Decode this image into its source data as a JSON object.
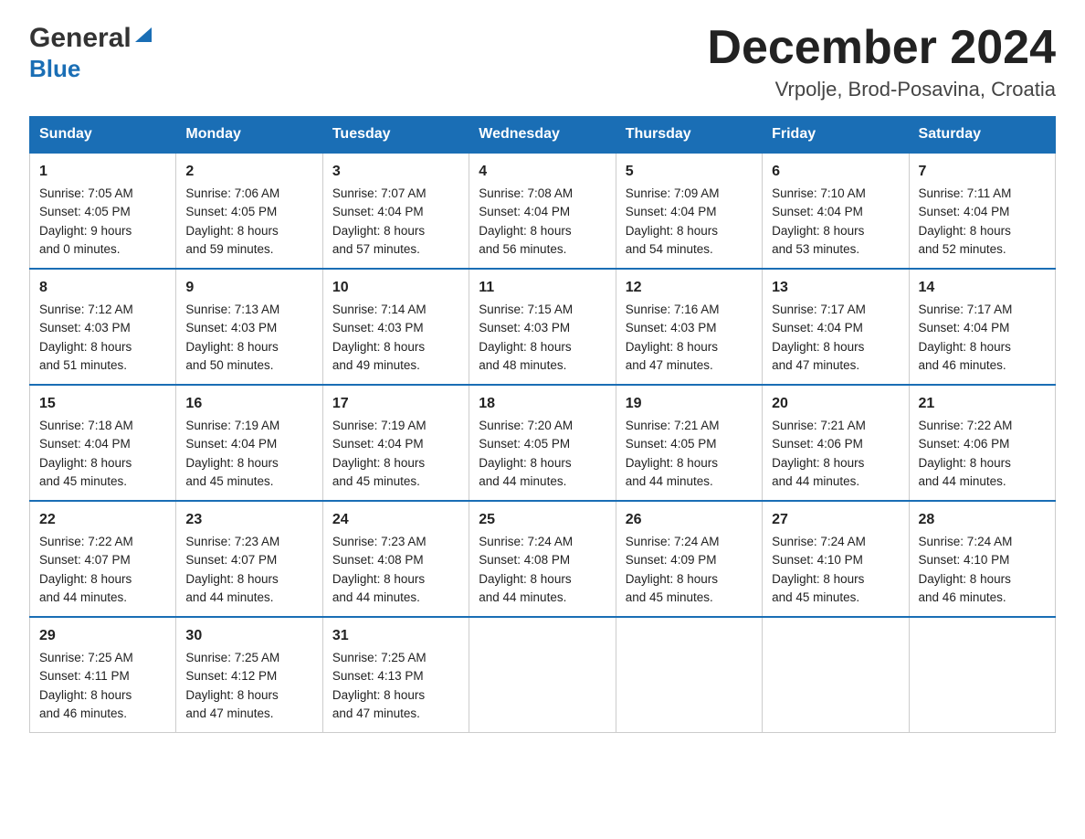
{
  "header": {
    "logo_general": "General",
    "logo_blue": "Blue",
    "month_title": "December 2024",
    "location": "Vrpolje, Brod-Posavina, Croatia"
  },
  "days_of_week": [
    "Sunday",
    "Monday",
    "Tuesday",
    "Wednesday",
    "Thursday",
    "Friday",
    "Saturday"
  ],
  "weeks": [
    [
      {
        "day": "1",
        "sunrise": "7:05 AM",
        "sunset": "4:05 PM",
        "daylight_hours": "9",
        "daylight_minutes": "0"
      },
      {
        "day": "2",
        "sunrise": "7:06 AM",
        "sunset": "4:05 PM",
        "daylight_hours": "8",
        "daylight_minutes": "59"
      },
      {
        "day": "3",
        "sunrise": "7:07 AM",
        "sunset": "4:04 PM",
        "daylight_hours": "8",
        "daylight_minutes": "57"
      },
      {
        "day": "4",
        "sunrise": "7:08 AM",
        "sunset": "4:04 PM",
        "daylight_hours": "8",
        "daylight_minutes": "56"
      },
      {
        "day": "5",
        "sunrise": "7:09 AM",
        "sunset": "4:04 PM",
        "daylight_hours": "8",
        "daylight_minutes": "54"
      },
      {
        "day": "6",
        "sunrise": "7:10 AM",
        "sunset": "4:04 PM",
        "daylight_hours": "8",
        "daylight_minutes": "53"
      },
      {
        "day": "7",
        "sunrise": "7:11 AM",
        "sunset": "4:04 PM",
        "daylight_hours": "8",
        "daylight_minutes": "52"
      }
    ],
    [
      {
        "day": "8",
        "sunrise": "7:12 AM",
        "sunset": "4:03 PM",
        "daylight_hours": "8",
        "daylight_minutes": "51"
      },
      {
        "day": "9",
        "sunrise": "7:13 AM",
        "sunset": "4:03 PM",
        "daylight_hours": "8",
        "daylight_minutes": "50"
      },
      {
        "day": "10",
        "sunrise": "7:14 AM",
        "sunset": "4:03 PM",
        "daylight_hours": "8",
        "daylight_minutes": "49"
      },
      {
        "day": "11",
        "sunrise": "7:15 AM",
        "sunset": "4:03 PM",
        "daylight_hours": "8",
        "daylight_minutes": "48"
      },
      {
        "day": "12",
        "sunrise": "7:16 AM",
        "sunset": "4:03 PM",
        "daylight_hours": "8",
        "daylight_minutes": "47"
      },
      {
        "day": "13",
        "sunrise": "7:17 AM",
        "sunset": "4:04 PM",
        "daylight_hours": "8",
        "daylight_minutes": "47"
      },
      {
        "day": "14",
        "sunrise": "7:17 AM",
        "sunset": "4:04 PM",
        "daylight_hours": "8",
        "daylight_minutes": "46"
      }
    ],
    [
      {
        "day": "15",
        "sunrise": "7:18 AM",
        "sunset": "4:04 PM",
        "daylight_hours": "8",
        "daylight_minutes": "45"
      },
      {
        "day": "16",
        "sunrise": "7:19 AM",
        "sunset": "4:04 PM",
        "daylight_hours": "8",
        "daylight_minutes": "45"
      },
      {
        "day": "17",
        "sunrise": "7:19 AM",
        "sunset": "4:04 PM",
        "daylight_hours": "8",
        "daylight_minutes": "45"
      },
      {
        "day": "18",
        "sunrise": "7:20 AM",
        "sunset": "4:05 PM",
        "daylight_hours": "8",
        "daylight_minutes": "44"
      },
      {
        "day": "19",
        "sunrise": "7:21 AM",
        "sunset": "4:05 PM",
        "daylight_hours": "8",
        "daylight_minutes": "44"
      },
      {
        "day": "20",
        "sunrise": "7:21 AM",
        "sunset": "4:06 PM",
        "daylight_hours": "8",
        "daylight_minutes": "44"
      },
      {
        "day": "21",
        "sunrise": "7:22 AM",
        "sunset": "4:06 PM",
        "daylight_hours": "8",
        "daylight_minutes": "44"
      }
    ],
    [
      {
        "day": "22",
        "sunrise": "7:22 AM",
        "sunset": "4:07 PM",
        "daylight_hours": "8",
        "daylight_minutes": "44"
      },
      {
        "day": "23",
        "sunrise": "7:23 AM",
        "sunset": "4:07 PM",
        "daylight_hours": "8",
        "daylight_minutes": "44"
      },
      {
        "day": "24",
        "sunrise": "7:23 AM",
        "sunset": "4:08 PM",
        "daylight_hours": "8",
        "daylight_minutes": "44"
      },
      {
        "day": "25",
        "sunrise": "7:24 AM",
        "sunset": "4:08 PM",
        "daylight_hours": "8",
        "daylight_minutes": "44"
      },
      {
        "day": "26",
        "sunrise": "7:24 AM",
        "sunset": "4:09 PM",
        "daylight_hours": "8",
        "daylight_minutes": "45"
      },
      {
        "day": "27",
        "sunrise": "7:24 AM",
        "sunset": "4:10 PM",
        "daylight_hours": "8",
        "daylight_minutes": "45"
      },
      {
        "day": "28",
        "sunrise": "7:24 AM",
        "sunset": "4:10 PM",
        "daylight_hours": "8",
        "daylight_minutes": "46"
      }
    ],
    [
      {
        "day": "29",
        "sunrise": "7:25 AM",
        "sunset": "4:11 PM",
        "daylight_hours": "8",
        "daylight_minutes": "46"
      },
      {
        "day": "30",
        "sunrise": "7:25 AM",
        "sunset": "4:12 PM",
        "daylight_hours": "8",
        "daylight_minutes": "47"
      },
      {
        "day": "31",
        "sunrise": "7:25 AM",
        "sunset": "4:13 PM",
        "daylight_hours": "8",
        "daylight_minutes": "47"
      },
      null,
      null,
      null,
      null
    ]
  ],
  "labels": {
    "sunrise": "Sunrise:",
    "sunset": "Sunset:",
    "daylight": "Daylight:",
    "hours": "hours",
    "and": "and",
    "minutes": "minutes."
  }
}
